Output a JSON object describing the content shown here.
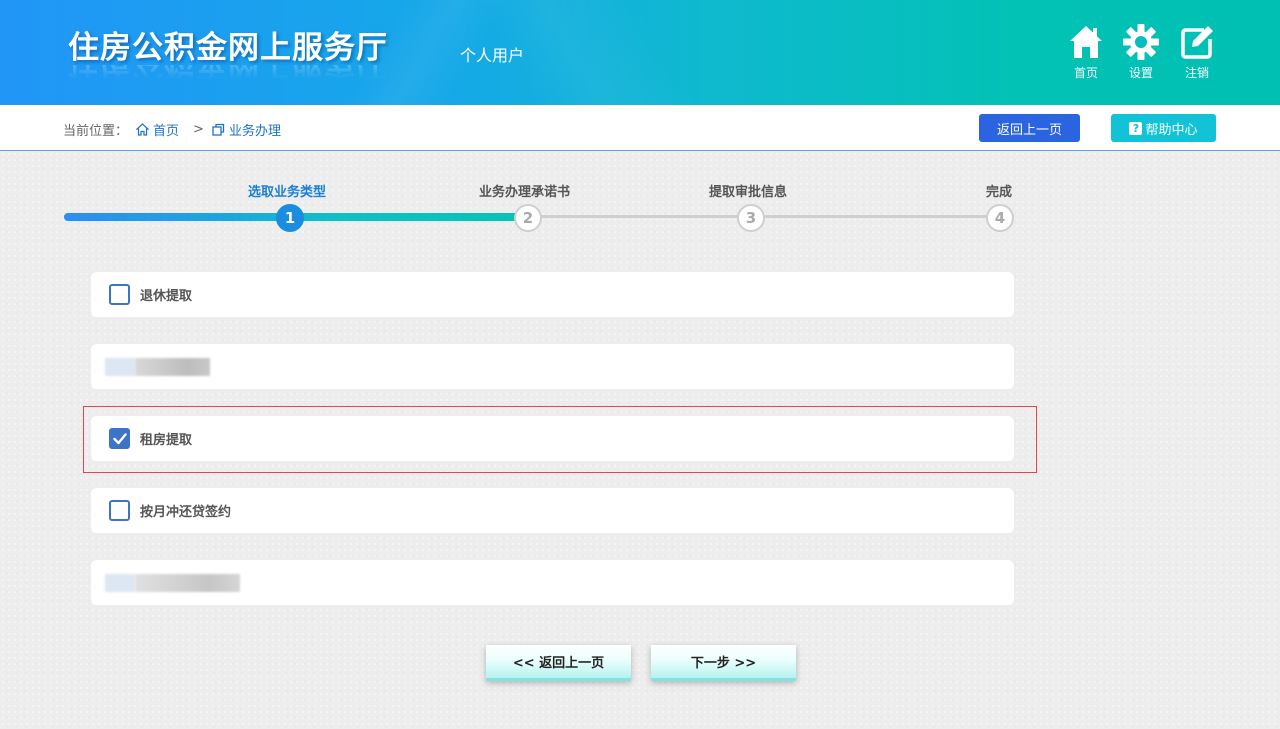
{
  "header": {
    "logo_text": "住房公积金网上服务厅",
    "user_type": "个人用户",
    "nav": [
      {
        "label": "首页",
        "icon": "home-icon"
      },
      {
        "label": "设置",
        "icon": "gear-icon"
      },
      {
        "label": "注销",
        "icon": "edit-icon"
      }
    ]
  },
  "breadcrumb": {
    "prefix": "当前位置：",
    "home": "首页",
    "separator": ">",
    "current": "业务办理"
  },
  "toolbar": {
    "back_label": "返回上一页",
    "help_label": "帮助中心",
    "help_glyph": "?"
  },
  "steps": [
    {
      "label": "选取业务类型",
      "number": "1",
      "state": "active"
    },
    {
      "label": "业务办理承诺书",
      "number": "2",
      "state": "pending"
    },
    {
      "label": "提取审批信息",
      "number": "3",
      "state": "pending"
    },
    {
      "label": "完成",
      "number": "4",
      "state": "pending"
    }
  ],
  "options": [
    {
      "label": "退休提取",
      "checked": false
    },
    {
      "label": "",
      "checked": false,
      "obscured": true
    },
    {
      "label": "租房提取",
      "checked": true
    },
    {
      "label": "按月冲还贷签约",
      "checked": false
    },
    {
      "label": "",
      "checked": false,
      "obscured": true
    }
  ],
  "buttons": {
    "prev_label": "<< 返回上一页",
    "next_label": "下一步 >>"
  },
  "colors": {
    "header_start": "#2196f7",
    "header_end": "#00bfb3",
    "primary_blue": "#2b64e0",
    "help_cyan": "#12c3d8",
    "checkbox_blue": "#3e74c7",
    "highlight_red": "#e2474f"
  }
}
